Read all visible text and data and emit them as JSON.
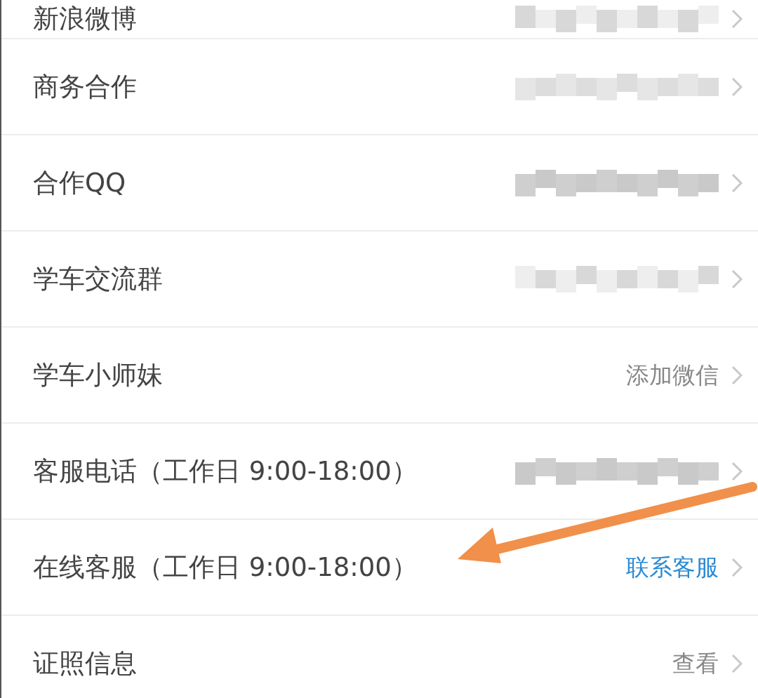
{
  "rows": [
    {
      "label": "新浪微博",
      "kind": "blurred"
    },
    {
      "label": "商务合作",
      "kind": "blurred"
    },
    {
      "label": "合作QQ",
      "kind": "blurred"
    },
    {
      "label": "学车交流群",
      "kind": "blurred"
    },
    {
      "label": "学车小师妹",
      "kind": "text",
      "value": "添加微信"
    },
    {
      "label": "客服电话（工作日 9:00-18:00）",
      "kind": "blurred"
    },
    {
      "label": "在线客服（工作日 9:00-18:00）",
      "kind": "link",
      "value": "联系客服"
    },
    {
      "label": "证照信息",
      "kind": "text",
      "value": "查看"
    }
  ]
}
